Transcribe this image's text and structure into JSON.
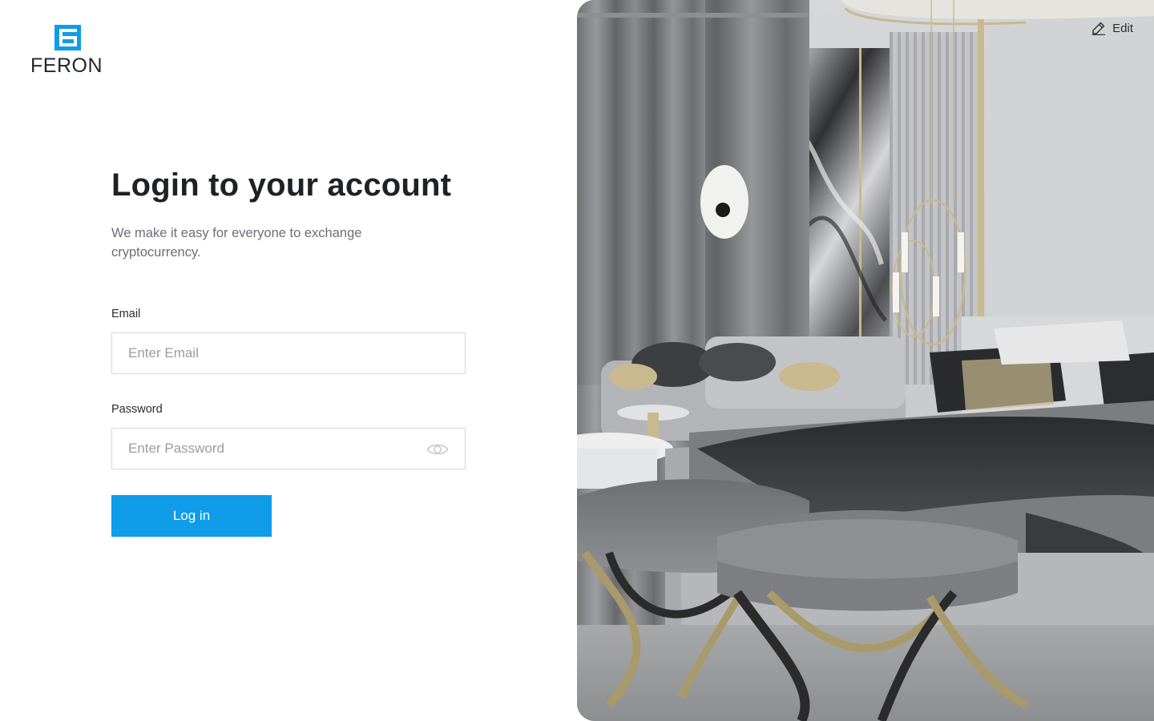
{
  "brand": {
    "name": "FERON",
    "accent_color": "#0f9ce9",
    "icon": "feron-logo-mark"
  },
  "login": {
    "title": "Login to your account",
    "subtitle": "We make it easy for everyone to exchange cryptocurrency.",
    "email": {
      "label": "Email",
      "placeholder": "Enter Email",
      "value": ""
    },
    "password": {
      "label": "Password",
      "placeholder": "Enter Password",
      "value": "",
      "toggle_icon": "eye-icon"
    },
    "submit_label": "Log in"
  },
  "hero": {
    "image": "luxury-bedroom-photo",
    "edit_label": "Edit",
    "edit_icon": "pencil-icon"
  }
}
